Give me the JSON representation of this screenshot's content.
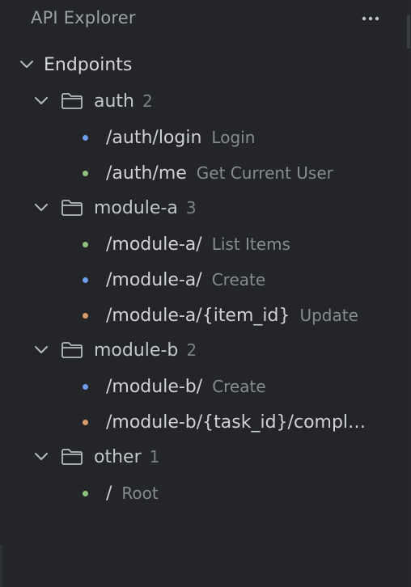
{
  "panel": {
    "title": "API Explorer",
    "more_icon": "more-horizontal-icon"
  },
  "tree": {
    "root_label": "Endpoints",
    "groups": [
      {
        "name": "auth",
        "count": "2",
        "endpoints": [
          {
            "path": "/auth/login",
            "desc": "Login",
            "dot_color": "#6d9fe8"
          },
          {
            "path": "/auth/me",
            "desc": "Get Current User",
            "dot_color": "#8fc27a"
          }
        ]
      },
      {
        "name": "module-a",
        "count": "3",
        "endpoints": [
          {
            "path": "/module-a/",
            "desc": "List Items",
            "dot_color": "#8fc27a"
          },
          {
            "path": "/module-a/",
            "desc": "Create",
            "dot_color": "#6d9fe8"
          },
          {
            "path": "/module-a/{item_id}",
            "desc": "Update",
            "dot_color": "#d79a6a"
          }
        ]
      },
      {
        "name": "module-b",
        "count": "2",
        "endpoints": [
          {
            "path": "/module-b/",
            "desc": "Create",
            "dot_color": "#6d9fe8"
          },
          {
            "path": "/module-b/{task_id}/compl…",
            "desc": "",
            "dot_color": "#d79a6a"
          }
        ]
      },
      {
        "name": "other",
        "count": "1",
        "endpoints": [
          {
            "path": "/",
            "desc": "Root",
            "dot_color": "#8fc27a"
          }
        ]
      }
    ]
  }
}
